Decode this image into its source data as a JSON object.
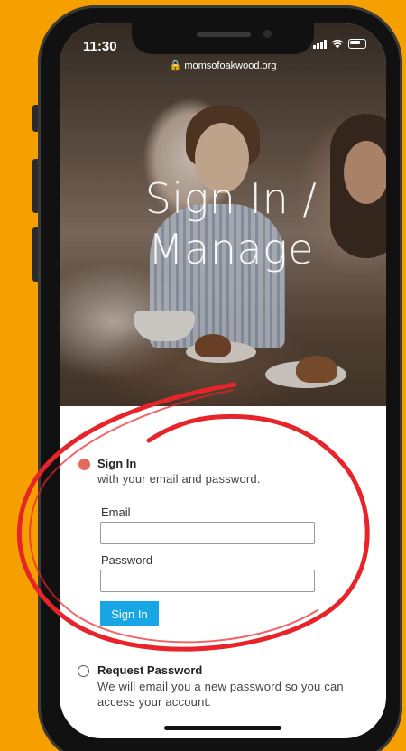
{
  "status_bar": {
    "time": "11:30",
    "url": "momsofoakwood.org"
  },
  "hero": {
    "title": "Sign In /\nManage"
  },
  "options": {
    "sign_in": {
      "title": "Sign In",
      "description": "with your email and password.",
      "selected": true
    },
    "request_password": {
      "title": "Request Password",
      "description": "We will email you a new password so you can access your account.",
      "selected": false
    }
  },
  "form": {
    "email_label": "Email",
    "email_value": "",
    "password_label": "Password",
    "password_value": "",
    "submit_label": "Sign In"
  },
  "colors": {
    "background": "#f5a000",
    "accent_button": "#17a6e3",
    "radio_selected": "#e46a5c",
    "annotation_circle": "#e8242b"
  },
  "icons": {
    "lock": "lock-icon",
    "signal": "signal-icon",
    "wifi": "wifi-icon",
    "battery": "battery-icon"
  }
}
